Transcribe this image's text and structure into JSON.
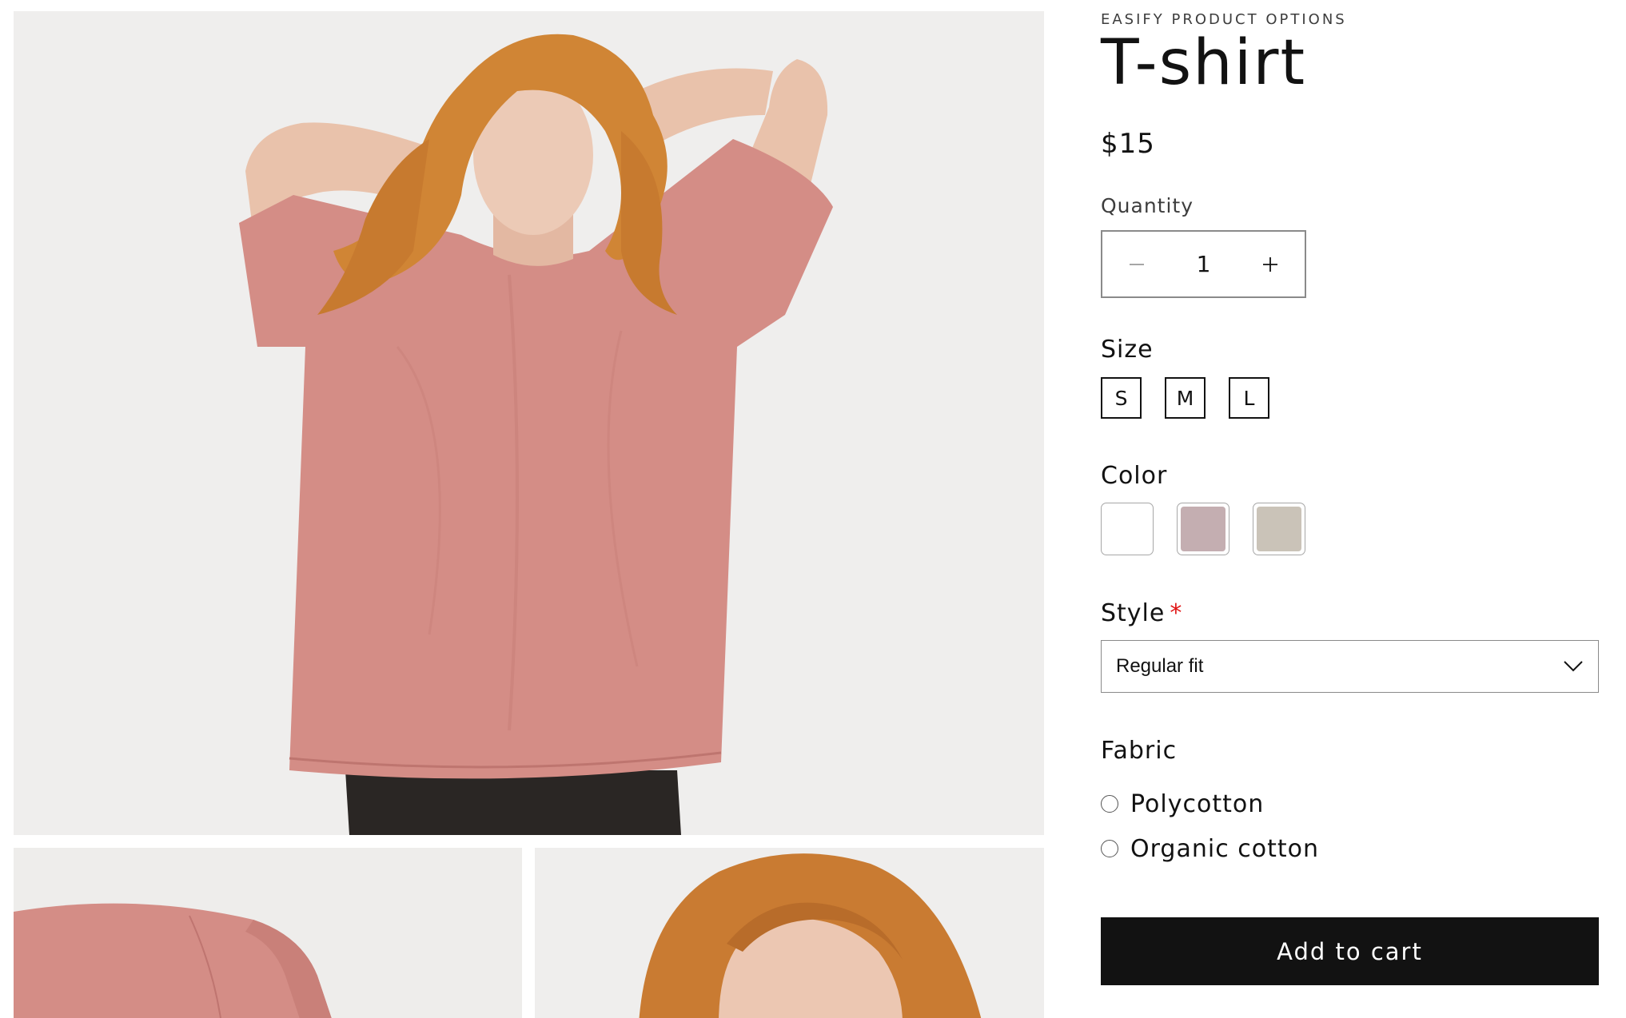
{
  "product": {
    "vendor": "EASIFY PRODUCT OPTIONS",
    "title": "T-shirt",
    "price": "$15"
  },
  "quantity": {
    "label": "Quantity",
    "value": "1",
    "decrease_icon": "minus-icon",
    "increase_icon": "plus-icon"
  },
  "size": {
    "label": "Size",
    "options": [
      "S",
      "M",
      "L"
    ]
  },
  "color": {
    "label": "Color",
    "swatches": [
      "#ffffff",
      "#c4aeb1",
      "#cac3b8"
    ]
  },
  "style": {
    "label": "Style",
    "required_mark": "*",
    "selected": "Regular fit",
    "dropdown_icon": "chevron-down-icon"
  },
  "fabric": {
    "label": "Fabric",
    "options": [
      "Polycotton",
      "Organic cotton"
    ]
  },
  "cart": {
    "button_label": "Add to cart"
  },
  "colors": {
    "primary": "#121212",
    "photo_background": "#efeeed",
    "shirt": "#d48d86",
    "required": "#e01515"
  }
}
